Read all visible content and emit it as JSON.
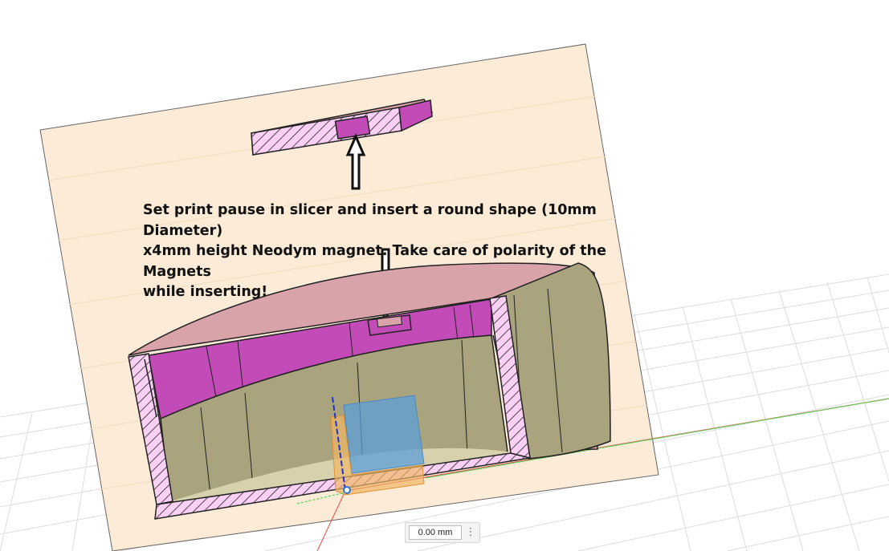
{
  "annotation": {
    "text": "Set print pause in slicer and insert a round shape (10mm Diameter)\nx4mm height Neodym magnet. Take care of polarity of the Magnets\nwhile inserting!"
  },
  "offset_input": {
    "value": "0.00 mm"
  },
  "more_menu": {
    "glyph": "⋮"
  },
  "colors": {
    "sketch_plane": "#fbebd7",
    "section_fill": "#c24bb7",
    "lid_top": "#d9a3aa",
    "wall": "#a9a47e",
    "selection_box": "#5d9fd8",
    "x_axis": "#e64a4a",
    "y_axis": "#5bd25b",
    "z_axis": "#2233cc"
  }
}
